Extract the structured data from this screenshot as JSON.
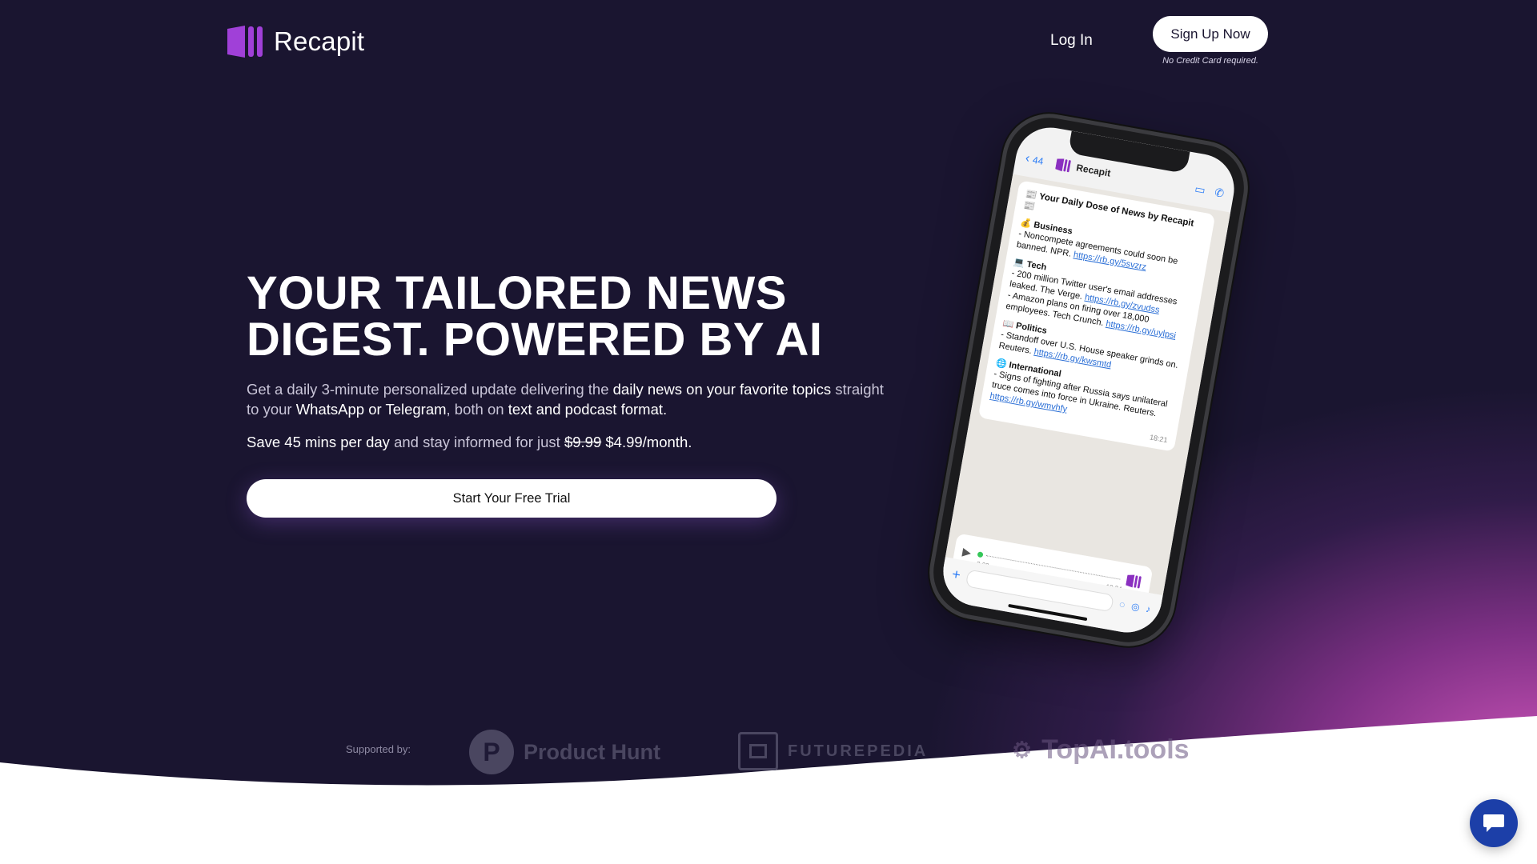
{
  "header": {
    "brand": "Recapit",
    "login_label": "Log In",
    "signup_label": "Sign Up Now",
    "signup_note": "No Credit Card required."
  },
  "hero": {
    "headline_line1": "YOUR TAILORED NEWS",
    "headline_line2": "DIGEST. POWERED BY AI",
    "sub1_a": "Get a daily 3-minute personalized update delivering the ",
    "sub1_b": "daily news on your favorite topics",
    "sub1_c": " straight to your ",
    "sub1_d": "WhatsApp or Telegram",
    "sub1_e": ", both on ",
    "sub1_f": "text and podcast format.",
    "sub2_a": "Save 45 mins per day",
    "sub2_b": " and stay informed for just ",
    "price_old": "$9.99",
    "price_new": " $4.99/month.",
    "cta_label": "Start Your Free Trial"
  },
  "phone": {
    "back_count": "44",
    "chat_name": "Recapit",
    "message_title": "Your Daily Dose of News by Recapit",
    "sections": [
      {
        "emoji": "💰",
        "title": "Business",
        "items": [
          {
            "text": "- Noncompete agreements could soon be banned. NPR. ",
            "link": "https://rb.gy/5svzrz"
          }
        ]
      },
      {
        "emoji": "💻",
        "title": "Tech",
        "items": [
          {
            "text": "- 200 million Twitter user's email addresses leaked. The Verge. ",
            "link": "https://rb.gy/zvudss"
          },
          {
            "text": "- Amazon plans on firing over 18,000 employees. Tech Crunch. ",
            "link": "https://rb.gy/uylpsi"
          }
        ]
      },
      {
        "emoji": "📖",
        "title": "Politics",
        "items": [
          {
            "text": "- Standoff over U.S. House speaker grinds on. Reuters. ",
            "link": "https://rb.gy/kwsmtd"
          }
        ]
      },
      {
        "emoji": "🌐",
        "title": "International",
        "items": [
          {
            "text": "- Signs of fighting after Russia says unilateral truce comes into force in Ukraine. Reuters. ",
            "link": "https://rb.gy/wmvhfy"
          }
        ]
      }
    ],
    "message_time": "18:21",
    "voice_duration": "2:00",
    "voice_time": "18:24"
  },
  "supported": {
    "label": "Supported by:",
    "partners": [
      "Product Hunt",
      "FUTUREPEDIA",
      "TopAI.tools"
    ]
  },
  "colors": {
    "background": "#1a1530",
    "accent": "#d356be",
    "logo": "#9b3fd6",
    "chat_widget": "#1c3fa8"
  },
  "icons": {
    "chat_widget": "chat-bubble-icon",
    "back": "chevron-left-icon",
    "video": "video-icon",
    "phone": "phone-icon"
  }
}
